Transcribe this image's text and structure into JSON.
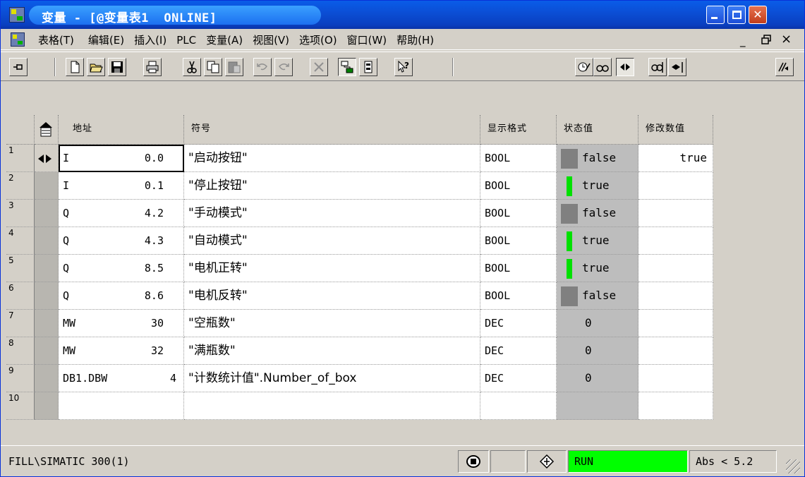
{
  "window": {
    "title": "变量 - [@变量表1  ONLINE]"
  },
  "menu": {
    "items": [
      "表格(T)",
      "编辑(E)",
      "插入(I)",
      "PLC",
      "变量(A)",
      "视图(V)",
      "选项(O)",
      "窗口(W)",
      "帮助(H)"
    ],
    "mdi_min": "_",
    "mdi_restore": "🗗",
    "mdi_close": "×"
  },
  "table": {
    "headers": {
      "address": "地址",
      "symbol": "符号",
      "display_format": "显示格式",
      "status_value": "状态值",
      "modify_value": "修改数值"
    },
    "rows": [
      {
        "num": "1",
        "area": "I",
        "addr": "0.0",
        "symbol": "\"启动按钮\"",
        "format": "BOOL",
        "status": "false",
        "status_on": false,
        "modify": "true",
        "trigger": true
      },
      {
        "num": "2",
        "area": "I",
        "addr": "0.1",
        "symbol": "\"停止按钮\"",
        "format": "BOOL",
        "status": "true",
        "status_on": true,
        "modify": ""
      },
      {
        "num": "3",
        "area": "Q",
        "addr": "4.2",
        "symbol": "\"手动模式\"",
        "format": "BOOL",
        "status": "false",
        "status_on": false,
        "modify": ""
      },
      {
        "num": "4",
        "area": "Q",
        "addr": "4.3",
        "symbol": "\"自动模式\"",
        "format": "BOOL",
        "status": "true",
        "status_on": true,
        "modify": ""
      },
      {
        "num": "5",
        "area": "Q",
        "addr": "8.5",
        "symbol": "\"电机正转\"",
        "format": "BOOL",
        "status": "true",
        "status_on": true,
        "modify": ""
      },
      {
        "num": "6",
        "area": "Q",
        "addr": "8.6",
        "symbol": "\"电机反转\"",
        "format": "BOOL",
        "status": "false",
        "status_on": false,
        "modify": ""
      },
      {
        "num": "7",
        "area": "MW",
        "addr": "30",
        "symbol": "\"空瓶数\"",
        "format": "DEC",
        "status": "0",
        "status_on": null,
        "modify": ""
      },
      {
        "num": "8",
        "area": "MW",
        "addr": "32",
        "symbol": "\"满瓶数\"",
        "format": "DEC",
        "status": "0",
        "status_on": null,
        "modify": ""
      },
      {
        "num": "9",
        "area": "DB1.DBW",
        "addr": "4",
        "symbol": "\"计数统计值\".Number_of_box",
        "format": "DEC",
        "status": "0",
        "status_on": null,
        "modify": ""
      },
      {
        "num": "10",
        "area": "",
        "addr": "",
        "symbol": "",
        "format": "",
        "status": "",
        "status_on": null,
        "modify": ""
      }
    ]
  },
  "status": {
    "path": "FILL\\SIMATIC 300(1)",
    "run": "RUN",
    "abs": "Abs < 5.2"
  },
  "colors": {
    "status_on": "#00e000",
    "status_off": "#808080",
    "run": "#00ff00"
  }
}
